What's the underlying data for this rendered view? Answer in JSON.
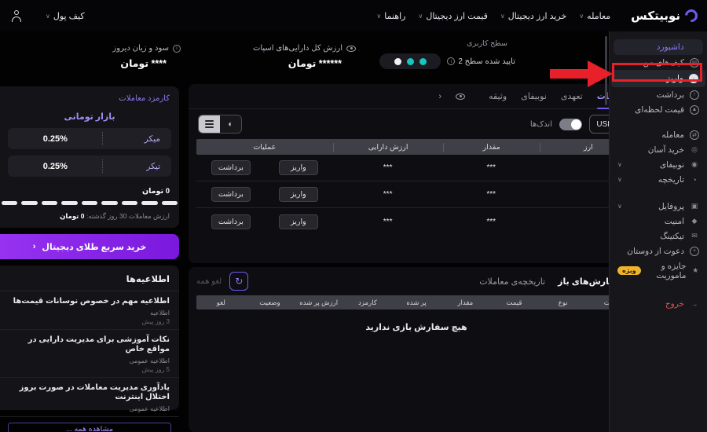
{
  "header": {
    "logo": "نوبیتکس",
    "nav_trade": "معامله",
    "nav_buy": "خرید ارز دیجیتال",
    "nav_prices": "قیمت ارز دیجیتال",
    "nav_guide": "راهنما",
    "wallet_menu": "کیف پول"
  },
  "sidebar": {
    "items": [
      {
        "label": "داشبورد"
      },
      {
        "label": "کیف‌های من"
      },
      {
        "label": "واریز"
      },
      {
        "label": "برداشت"
      },
      {
        "label": "قیمت لحظه‌ای"
      },
      {
        "label": "معامله"
      },
      {
        "label": "خرید آسان"
      },
      {
        "label": "نوبیفای"
      },
      {
        "label": "تاریخچه"
      },
      {
        "label": "پروفایل"
      },
      {
        "label": "امنیت"
      },
      {
        "label": "تیکتینگ"
      },
      {
        "label": "دعوت از دوستان"
      },
      {
        "label": "جایزه و ماموریت",
        "badge": "ویژه"
      },
      {
        "label": "خروج"
      }
    ]
  },
  "summary": {
    "level_title": "سطح کاربری",
    "level_status": "تایید شده سطح 2",
    "assets_label": "ارزش کل دارایی‌های اسپات",
    "assets_value": "****** تومان",
    "pnl_label": "سود و زیان دیروز",
    "pnl_value": "**** تومان"
  },
  "wallet": {
    "tabs": [
      {
        "label": "اسپات"
      },
      {
        "label": "تعهدی"
      },
      {
        "label": "نوبیفای"
      },
      {
        "label": "وثیقه"
      }
    ],
    "collapse_chevron": "‹",
    "currency_button": "USDT",
    "small_assets_toggle": "اندک‌ها",
    "headers": [
      "ارز",
      "مقدار",
      "ارزش دارایی",
      "عملیات"
    ],
    "rows": [
      {
        "amount": "***",
        "value": "***",
        "deposit": "واریز",
        "withdraw": "برداشت"
      },
      {
        "amount": "***",
        "value": "***",
        "deposit": "واریز",
        "withdraw": "برداشت"
      },
      {
        "amount": "***",
        "value": "***",
        "deposit": "واریز",
        "withdraw": "برداشت"
      }
    ]
  },
  "orders": {
    "tab_open": "سفارش‌های باز",
    "tab_history": "تاریخچه‌ی معاملات",
    "cancel_all": "لغو همه",
    "refresh_icon": "↻",
    "headers": [
      "سمت",
      "نوع",
      "قیمت",
      "مقدار",
      "پر شده",
      "کارمزد",
      "ارزش پر شده",
      "وضعیت",
      "لغو"
    ],
    "empty": "هیچ سفارش بازی ندارید"
  },
  "fees": {
    "title": "کارمزد معاملات",
    "market": "بازار تومانی",
    "rows": [
      {
        "label": "میکر",
        "value": "0.25%"
      },
      {
        "label": "تیکر",
        "value": "0.25%"
      }
    ],
    "volume_value": "0 تومان",
    "volume_label": "ارزش معاملات 30 روز گذشته: ",
    "volume_amount": "0 تومان"
  },
  "quick_buy": {
    "label": "خرید سریع طلای دیجیتال",
    "chevron": "‹"
  },
  "announcements": {
    "title": "اطلاعیه‌ها",
    "items": [
      {
        "title": "اطلاعیه مهم در خصوص نوسانات قیمت‌ها",
        "category": "اطلاعیه",
        "time": "3 روز پیش"
      },
      {
        "title": "نکات آموزشی برای مدیریت دارایی در مواقع خاص",
        "category": "اطلاعیه عمومی",
        "time": "5 روز پیش"
      },
      {
        "title": "یادآوری مدیریت معاملات در صورت بروز اختلال اینترنت",
        "category": "اطلاعیه عمومی",
        "time": ""
      }
    ],
    "view_all": "مشاهده همه ..."
  },
  "colors": {
    "accent_purple": "#6c5bf0",
    "teal": "#16c6c0",
    "badge_yellow": "#f0b429",
    "annotation_red": "#e8202a",
    "logout_red": "#e5534b"
  }
}
